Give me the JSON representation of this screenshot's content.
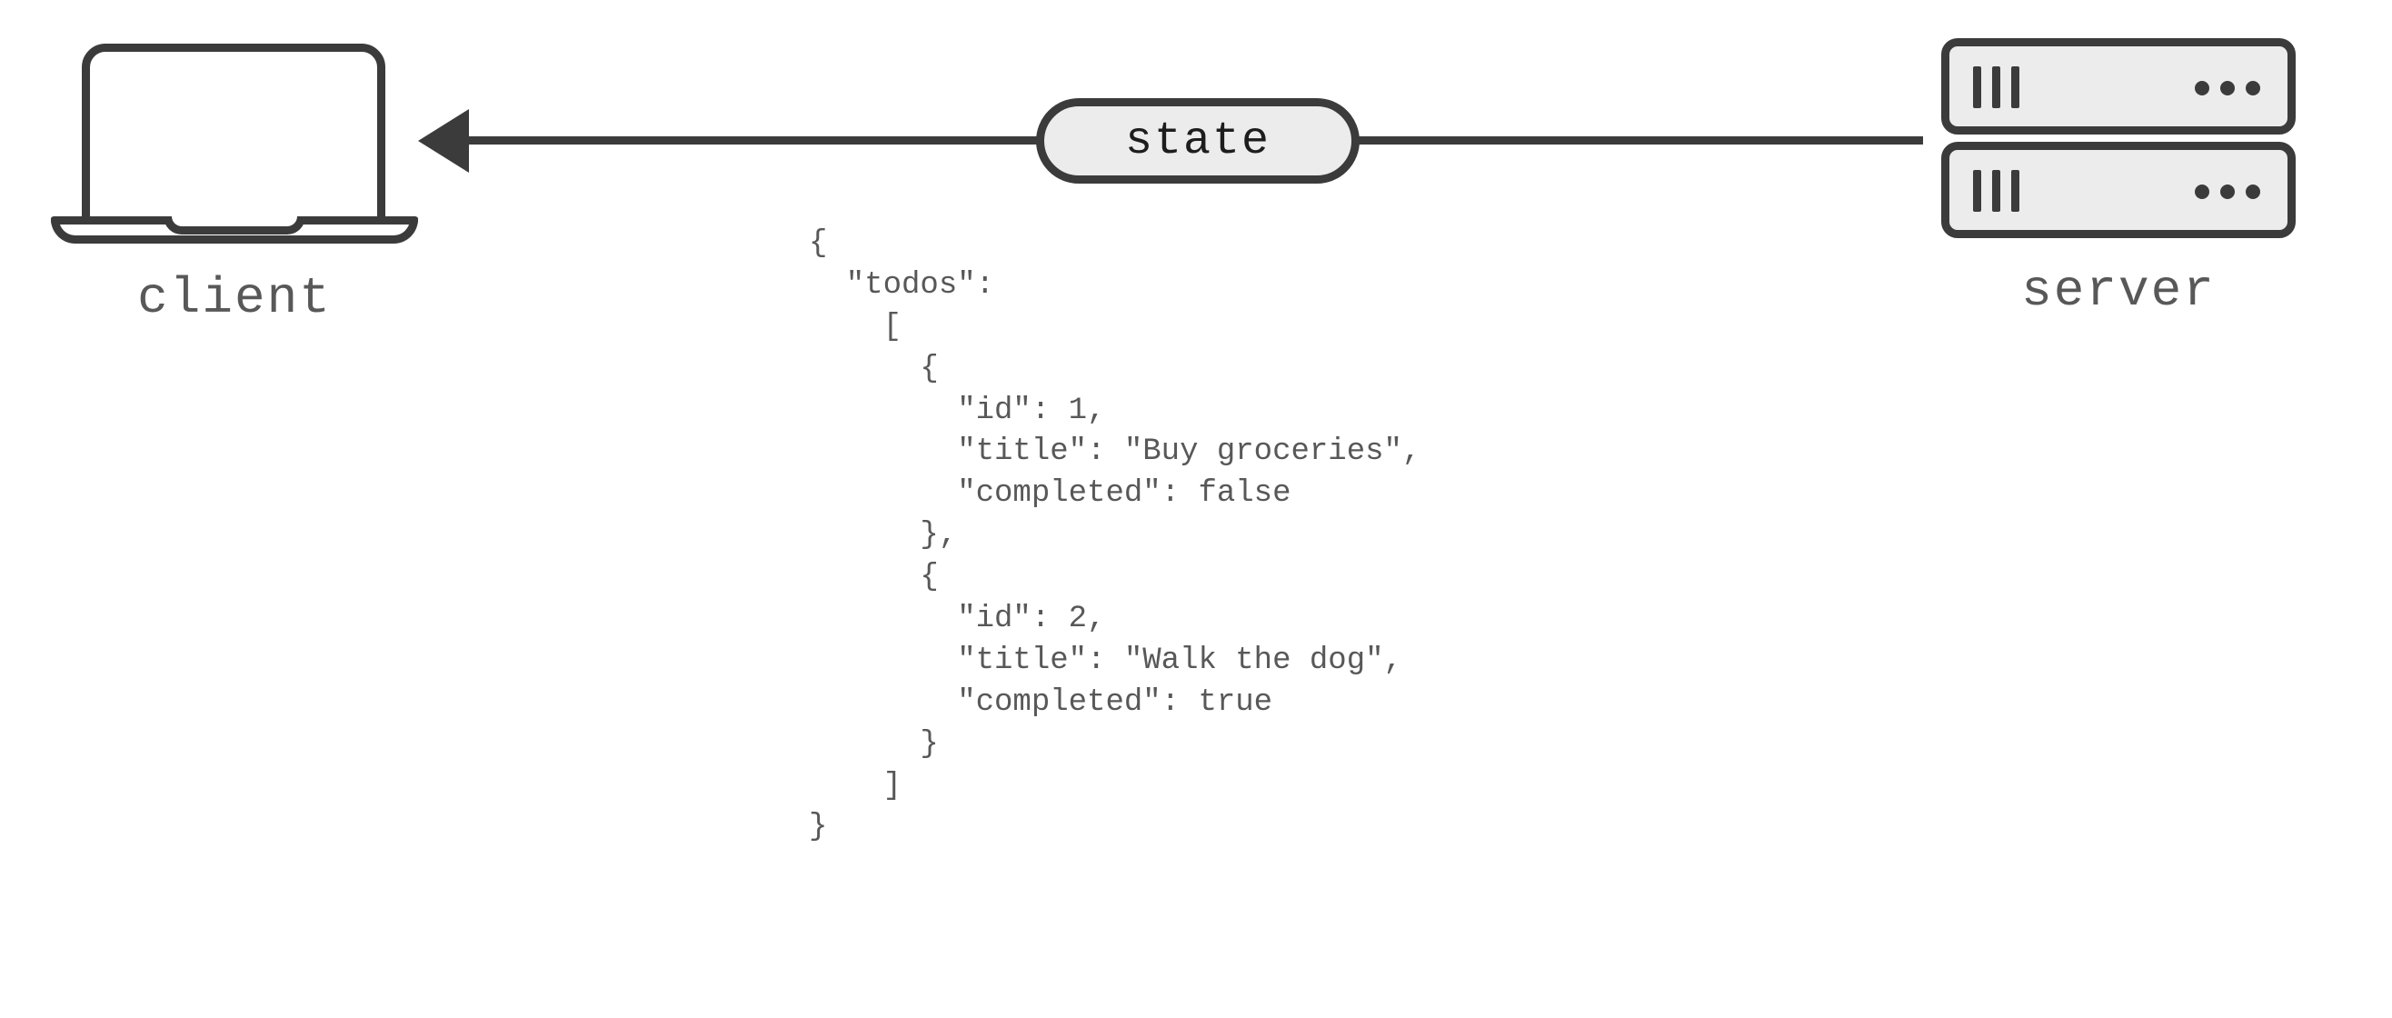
{
  "left_node": {
    "label": "client"
  },
  "right_node": {
    "label": "server"
  },
  "edge": {
    "label": "state",
    "direction": "server_to_client"
  },
  "payload_lines": [
    "{",
    "  \"todos\":",
    "    [",
    "      {",
    "        \"id\": 1,",
    "        \"title\": \"Buy groceries\",",
    "        \"completed\": false",
    "      },",
    "      {",
    "        \"id\": 2,",
    "        \"title\": \"Walk the dog\",",
    "        \"completed\": true",
    "      }",
    "    ]",
    "}"
  ],
  "payload_value": {
    "todos": [
      {
        "id": 1,
        "title": "Buy groceries",
        "completed": false
      },
      {
        "id": 2,
        "title": "Walk the dog",
        "completed": true
      }
    ]
  }
}
